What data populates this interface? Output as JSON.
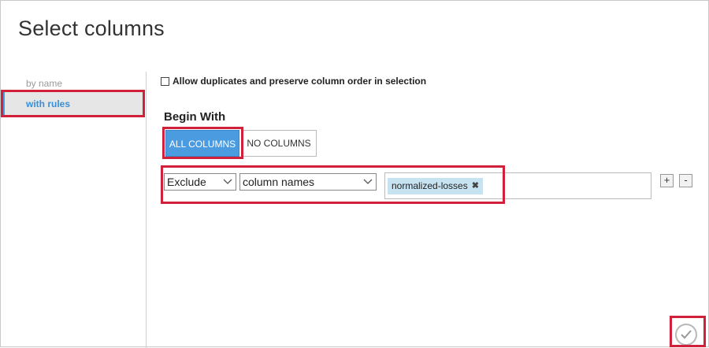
{
  "dialog": {
    "title": "Select columns"
  },
  "sidebar": {
    "items": [
      {
        "label": "by name"
      },
      {
        "label": "with rules"
      }
    ]
  },
  "options": {
    "allow_duplicates_label": "Allow duplicates and preserve column order in selection",
    "allow_duplicates_checked": false
  },
  "begin_with": {
    "heading": "Begin With",
    "all_columns": "ALL COLUMNS",
    "no_columns": "NO COLUMNS",
    "selected": "ALL COLUMNS"
  },
  "rule": {
    "mode_value": "Exclude",
    "type_value": "column names",
    "tags": [
      {
        "label": "normalized-losses",
        "remove_glyph": "✖"
      }
    ],
    "add_label": "+",
    "remove_label": "-"
  },
  "footer": {
    "ok_icon": "checkmark-icon"
  },
  "colors": {
    "accent": "#4b9be0",
    "highlight": "#d0203a",
    "tag": "#c7e2f0"
  }
}
